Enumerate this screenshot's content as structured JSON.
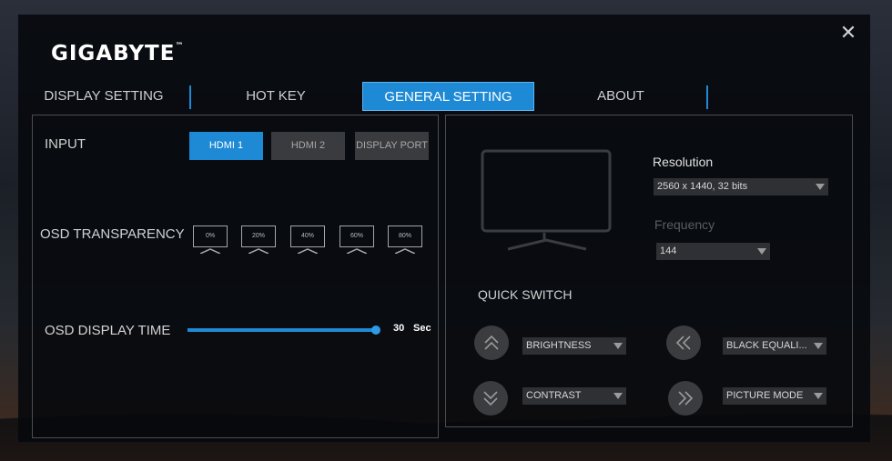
{
  "brand": {
    "name": "GIGABYTE",
    "mark": "™"
  },
  "tabs": [
    {
      "label": "DISPLAY SETTING"
    },
    {
      "label": "HOT KEY"
    },
    {
      "label": "GENERAL SETTING"
    },
    {
      "label": "ABOUT"
    }
  ],
  "active_tab": "GENERAL SETTING",
  "left": {
    "input_label": "INPUT",
    "inputs": [
      "HDMI 1",
      "HDMI 2",
      "DISPLAY PORT"
    ],
    "selected_input": "HDMI 1",
    "transparency_label": "OSD TRANSPARENCY",
    "transparency_options": [
      "0%",
      "20%",
      "40%",
      "60%",
      "80%"
    ],
    "display_time_label": "OSD DISPLAY TIME",
    "display_time_value": "30",
    "display_time_unit": "Sec",
    "display_time_fraction": 1.0
  },
  "right": {
    "resolution_label": "Resolution",
    "resolution_value": "2560 x 1440, 32 bits",
    "frequency_label": "Frequency",
    "frequency_value": "144",
    "quick_switch_label": "QUICK SWITCH",
    "quick": {
      "up": "BRIGHTNESS",
      "down": "CONTRAST",
      "left": "BLACK EQUALI...",
      "right": "PICTURE MODE"
    }
  },
  "colors": {
    "accent": "#1e8ad6",
    "panel_border": "#4a4d52"
  }
}
